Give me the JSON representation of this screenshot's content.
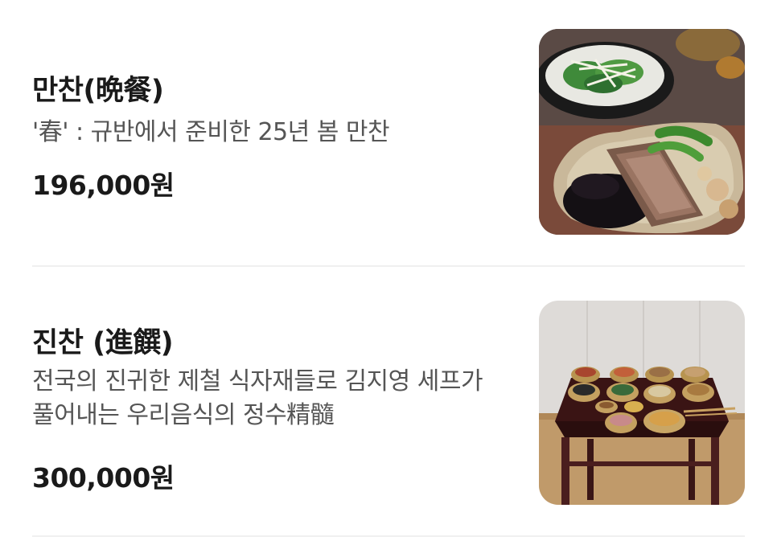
{
  "menu": {
    "items": [
      {
        "title": "만찬(晩餐)",
        "description": "'春' : 규반에서 준비한 25년 봄 만찬",
        "price": "196,000원",
        "image": "dinner-dish-photo"
      },
      {
        "title": "진찬 (進饌)",
        "description": "전국의 진귀한 제철 식자재들로 김지영 세프가 풀어내는 우리음식의 정수精髓",
        "price": "300,000원",
        "image": "royal-table-setting-photo"
      }
    ]
  }
}
